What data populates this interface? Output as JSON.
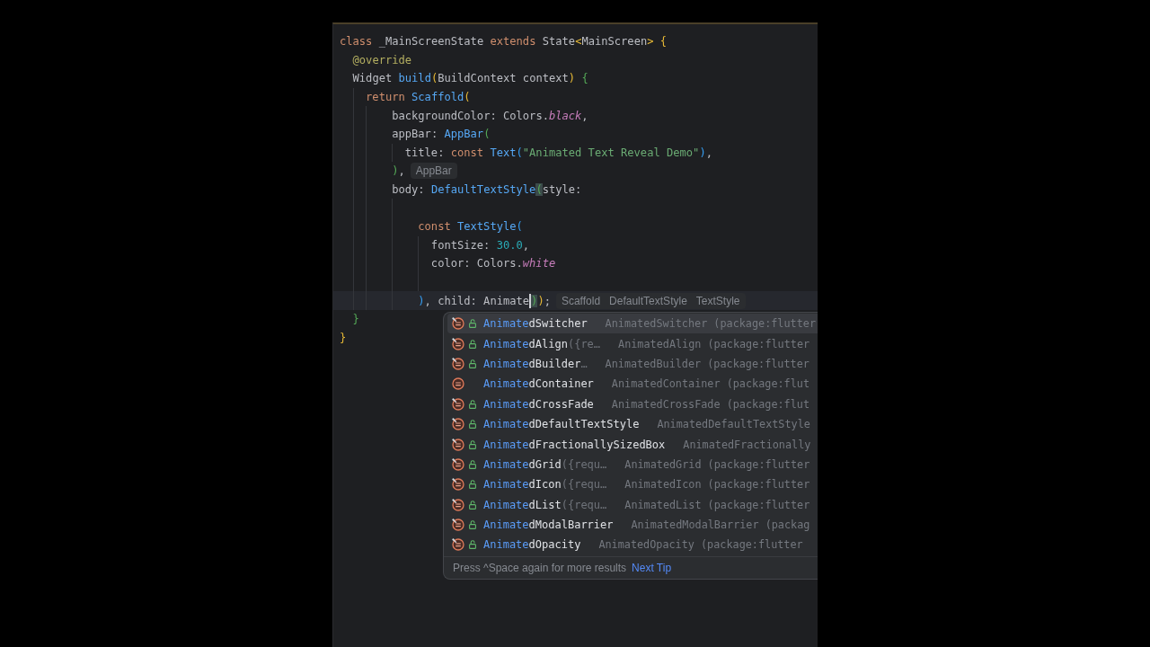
{
  "editor": {
    "lines": [
      {
        "kind": "code",
        "current": false,
        "tokens": [
          {
            "kind": "keyword",
            "text": "class "
          },
          {
            "kind": "plain",
            "text": "_MainScreenState "
          },
          {
            "kind": "keyword",
            "text": "extends "
          },
          {
            "kind": "plain",
            "text": "State"
          },
          {
            "kind": "paren1",
            "text": "<"
          },
          {
            "kind": "plain",
            "text": "MainScreen"
          },
          {
            "kind": "paren1",
            "text": ">"
          },
          {
            "kind": "paren1",
            "text": " {"
          }
        ]
      },
      {
        "kind": "code",
        "current": false,
        "tokens": [
          {
            "kind": "annotation",
            "text": "  @override"
          }
        ]
      },
      {
        "kind": "code",
        "current": false,
        "tokens": [
          {
            "kind": "plain",
            "text": "  Widget "
          },
          {
            "kind": "call",
            "text": "build"
          },
          {
            "kind": "paren1",
            "text": "("
          },
          {
            "kind": "plain",
            "text": "BuildContext context"
          },
          {
            "kind": "paren1",
            "text": ")"
          },
          {
            "kind": "paren2",
            "text": " {"
          }
        ]
      },
      {
        "kind": "code",
        "current": false,
        "tokens": [
          {
            "kind": "keyword",
            "text": "    return "
          },
          {
            "kind": "call",
            "text": "Scaffold"
          },
          {
            "kind": "paren1",
            "text": "("
          }
        ]
      },
      {
        "kind": "code",
        "current": false,
        "tokens": [
          {
            "kind": "plain",
            "text": "        backgroundColor: Colors."
          },
          {
            "kind": "constant",
            "text": "black"
          },
          {
            "kind": "plain",
            "text": ","
          }
        ]
      },
      {
        "kind": "code",
        "current": false,
        "tokens": [
          {
            "kind": "plain",
            "text": "        appBar: "
          },
          {
            "kind": "call",
            "text": "AppBar"
          },
          {
            "kind": "paren2",
            "text": "("
          }
        ]
      },
      {
        "kind": "code",
        "current": false,
        "tokens": [
          {
            "kind": "plain",
            "text": "          title: "
          },
          {
            "kind": "keyword",
            "text": "const "
          },
          {
            "kind": "call",
            "text": "Text"
          },
          {
            "kind": "paren3",
            "text": "("
          },
          {
            "kind": "string",
            "text": "\"Animated Text Reveal Demo\""
          },
          {
            "kind": "paren3",
            "text": ")"
          },
          {
            "kind": "plain",
            "text": ","
          }
        ]
      },
      {
        "kind": "code",
        "current": false,
        "tokens": [
          {
            "kind": "paren2",
            "text": "        )"
          },
          {
            "kind": "plain",
            "text": ","
          },
          {
            "kind": "hint",
            "items": [
              "AppBar"
            ]
          }
        ]
      },
      {
        "kind": "code",
        "current": false,
        "tokens": [
          {
            "kind": "plain",
            "text": "        body: "
          },
          {
            "kind": "call",
            "text": "DefaultTextStyle"
          },
          {
            "kind": "match",
            "text": "("
          },
          {
            "kind": "plain",
            "text": "style:"
          }
        ]
      },
      {
        "kind": "blank",
        "current": false
      },
      {
        "kind": "code",
        "current": false,
        "tokens": [
          {
            "kind": "keyword",
            "text": "            const "
          },
          {
            "kind": "call",
            "text": "TextStyle"
          },
          {
            "kind": "paren3",
            "text": "("
          }
        ]
      },
      {
        "kind": "code",
        "current": false,
        "tokens": [
          {
            "kind": "plain",
            "text": "              fontSize: "
          },
          {
            "kind": "number",
            "text": "30.0"
          },
          {
            "kind": "plain",
            "text": ","
          }
        ]
      },
      {
        "kind": "code",
        "current": false,
        "tokens": [
          {
            "kind": "plain",
            "text": "              color: Colors."
          },
          {
            "kind": "constant",
            "text": "white"
          }
        ]
      },
      {
        "kind": "blank",
        "current": false
      },
      {
        "kind": "code",
        "current": true,
        "tokens": [
          {
            "kind": "paren3",
            "text": "            )"
          },
          {
            "kind": "plain",
            "text": ", child: Animate"
          },
          {
            "kind": "caret"
          },
          {
            "kind": "match",
            "text": ")"
          },
          {
            "kind": "paren1",
            "text": ")"
          },
          {
            "kind": "plain",
            "text": ";"
          },
          {
            "kind": "hint",
            "items": [
              "Scaffold",
              "DefaultTextStyle",
              "TextStyle"
            ]
          }
        ]
      },
      {
        "kind": "code",
        "current": false,
        "tokens": [
          {
            "kind": "paren2",
            "text": "  }"
          }
        ]
      },
      {
        "kind": "code",
        "current": false,
        "tokens": [
          {
            "kind": "paren1",
            "text": "}"
          }
        ]
      }
    ]
  },
  "completion": {
    "items": [
      {
        "kind": "constructor",
        "selected": true,
        "prefix": "Animate",
        "suffix": "dSwitcher",
        "type": "AnimatedSwitcher (package:flutter"
      },
      {
        "kind": "constructor",
        "selected": false,
        "prefix": "Animate",
        "suffix": "dAlign",
        "params": "({re…",
        "type": "AnimatedAlign (package:flutter"
      },
      {
        "kind": "constructor",
        "selected": false,
        "prefix": "Animate",
        "suffix": "dBuilder",
        "params": "…",
        "type": "AnimatedBuilder (package:flutter"
      },
      {
        "kind": "class",
        "selected": false,
        "prefix": "Animate",
        "suffix": "dContainer",
        "type": "AnimatedContainer (package:flut"
      },
      {
        "kind": "constructor",
        "selected": false,
        "prefix": "Animate",
        "suffix": "dCrossFade",
        "type": "AnimatedCrossFade (package:flut"
      },
      {
        "kind": "constructor",
        "selected": false,
        "prefix": "Animate",
        "suffix": "dDefaultTextStyle",
        "type": "AnimatedDefaultTextStyle"
      },
      {
        "kind": "constructor",
        "selected": false,
        "prefix": "Animate",
        "suffix": "dFractionallySizedBox",
        "type": "AnimatedFractionally"
      },
      {
        "kind": "constructor",
        "selected": false,
        "prefix": "Animate",
        "suffix": "dGrid",
        "params": "({requ…",
        "type": "AnimatedGrid (package:flutter"
      },
      {
        "kind": "constructor",
        "selected": false,
        "prefix": "Animate",
        "suffix": "dIcon",
        "params": "({requ…",
        "type": "AnimatedIcon (package:flutter"
      },
      {
        "kind": "constructor",
        "selected": false,
        "prefix": "Animate",
        "suffix": "dList",
        "params": "({requ…",
        "type": "AnimatedList (package:flutter"
      },
      {
        "kind": "constructor",
        "selected": false,
        "prefix": "Animate",
        "suffix": "dModalBarrier",
        "type": "AnimatedModalBarrier (packag"
      },
      {
        "kind": "constructor",
        "selected": false,
        "prefix": "Animate",
        "suffix": "dOpacity",
        "type": "AnimatedOpacity (package:flutter"
      }
    ],
    "footer": {
      "hint": "Press ^Space again for more results",
      "link": "Next Tip"
    }
  }
}
